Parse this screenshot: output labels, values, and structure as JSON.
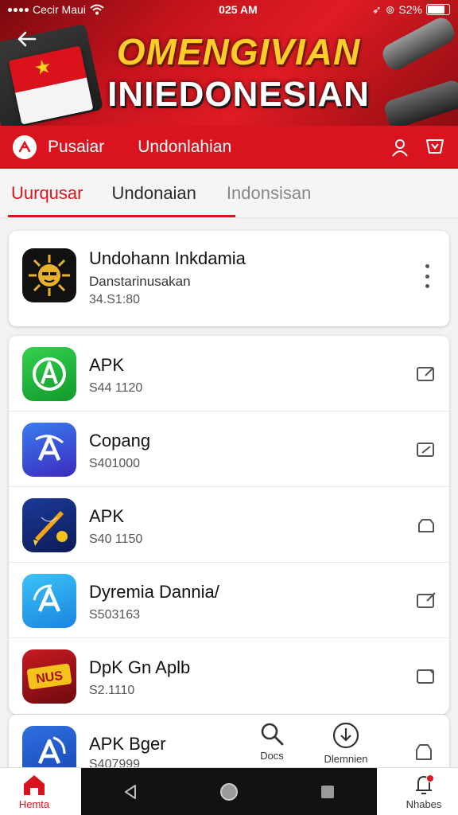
{
  "status_bar": {
    "carrier": "Cecir Maui",
    "time": "025 AM",
    "battery_text": "S2%",
    "battery_level": 0.82
  },
  "banner": {
    "title_line1": "OMENGIVIAN",
    "title_line2": "INIEDONESIAN"
  },
  "nav": {
    "home_label": "Pusaiar",
    "download_label": "Undonlahian"
  },
  "tabs": [
    {
      "label": "Uurqusar",
      "active": true
    },
    {
      "label": "Undonaian",
      "active": false
    },
    {
      "label": "Indonsisan",
      "active": false
    }
  ],
  "featured": {
    "name": "Undohann Inkdamia",
    "subtitle": "Danstarinusakan",
    "size": "34.S1:80"
  },
  "list": [
    {
      "name": "APK",
      "size": "S44 1120",
      "icon": "letter-a-green-icon",
      "color": "#1fb33a"
    },
    {
      "name": "Copang",
      "size": "S401000",
      "icon": "letter-a-blue-icon",
      "color": "#2f5fe0"
    },
    {
      "name": "APK",
      "size": "S40 1150",
      "icon": "keris-icon",
      "color": "#14286e"
    },
    {
      "name": "Dyremia Dannia/",
      "size": "S503163",
      "icon": "letter-a-lightblue-icon",
      "color": "#1ea5ee"
    },
    {
      "name": "DpK Gn Aplb",
      "size": "S2.1110",
      "icon": "logo-badge-icon",
      "color": "#b3121b"
    }
  ],
  "last_item": {
    "name": "APK Bger",
    "size": "S407999"
  },
  "floating": {
    "search_label": "Docs",
    "download_label": "Dlemnien"
  },
  "bottom_bar": {
    "home_label": "Hemta",
    "notes_label": "Nhabes"
  },
  "colors": {
    "accent": "#d9141e",
    "banner_gold": "#ffcc2a"
  }
}
